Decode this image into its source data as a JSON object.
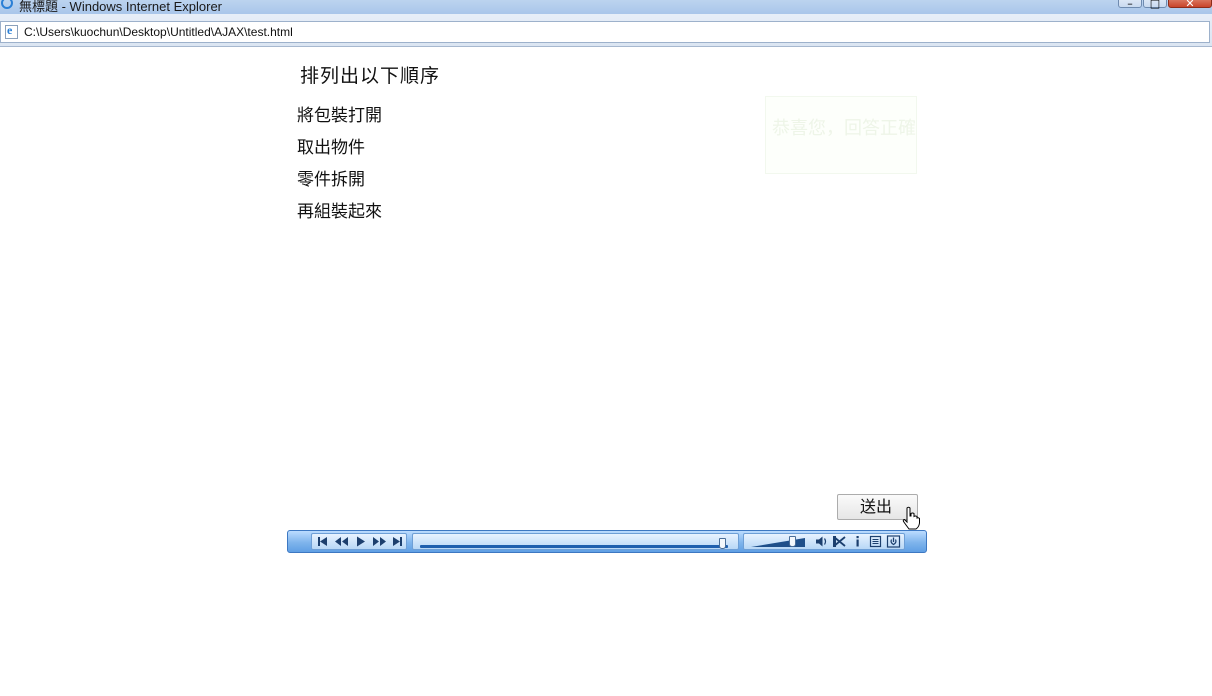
{
  "window": {
    "title": "無標題 - Windows Internet Explorer",
    "minimize_label": "–",
    "maximize_label": "□",
    "close_label": "✕"
  },
  "address_bar": {
    "url": "C:\\Users\\kuochun\\Desktop\\Untitled\\AJAX\\test.html"
  },
  "page": {
    "heading": "排列出以下順序",
    "items": [
      "將包裝打開",
      "取出物件",
      "零件拆開",
      "再組裝起來"
    ],
    "feedback_text": "恭喜您，回答正確",
    "submit_label": "送出"
  },
  "player": {
    "seek_position": 0.98,
    "volume_level": 0.75,
    "controls": [
      "previous",
      "rewind",
      "play",
      "fast-forward",
      "next",
      "mute",
      "shuffle",
      "info",
      "playlist",
      "power"
    ]
  }
}
